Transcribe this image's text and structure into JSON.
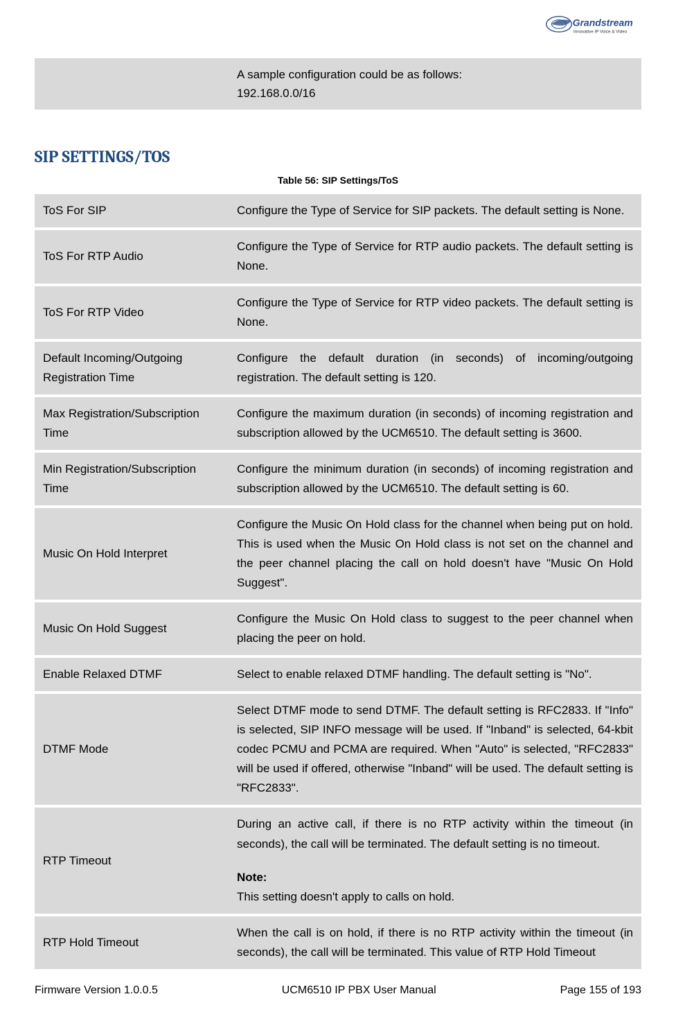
{
  "logo": {
    "brand": "Grandstream",
    "tagline": "Innovative IP Voice & Video"
  },
  "intro_row": {
    "label": "",
    "line1": "A sample configuration could be as follows:",
    "line2": "192.168.0.0/16"
  },
  "section_title": "SIP SETTINGS/TOS",
  "table_caption": "Table 56: SIP Settings/ToS",
  "rows": [
    {
      "label": "ToS For SIP",
      "desc": "Configure the Type of Service for SIP packets. The default setting is None."
    },
    {
      "label": "ToS For RTP Audio",
      "desc": "Configure the Type of Service for RTP audio packets. The default setting is None."
    },
    {
      "label": "ToS For RTP Video",
      "desc": "Configure the Type of Service for RTP video packets. The default setting is None."
    },
    {
      "label": "Default Incoming/Outgoing Registration Time",
      "desc": "Configure the default duration (in seconds) of incoming/outgoing registration. The default setting is 120."
    },
    {
      "label": "Max Registration/Subscription Time",
      "desc": "Configure the maximum duration (in seconds) of incoming registration and subscription allowed by the UCM6510. The default setting is 3600."
    },
    {
      "label": "Min Registration/Subscription Time",
      "desc": "Configure the minimum duration (in seconds) of incoming registration and subscription allowed by the UCM6510. The default setting is 60."
    },
    {
      "label": "Music On Hold Interpret",
      "desc": "Configure the Music On Hold class for the channel when being put on hold. This is used when the Music On Hold class is not set on the channel and the peer channel placing the call on hold doesn't have \"Music On Hold Suggest\"."
    },
    {
      "label": "Music On Hold Suggest",
      "desc": "Configure the Music On Hold class to suggest to the peer channel when placing the peer on hold."
    },
    {
      "label": "Enable Relaxed DTMF",
      "desc": "Select to enable relaxed DTMF handling. The default setting is \"No\"."
    },
    {
      "label": "DTMF Mode",
      "desc": "Select DTMF mode to send DTMF. The default setting is RFC2833. If \"Info\" is selected, SIP INFO message will be used. If \"Inband\" is selected, 64-kbit codec PCMU and PCMA are required. When \"Auto\" is selected, \"RFC2833\" will be used if offered, otherwise \"Inband\" will be used. The default setting is \"RFC2833\"."
    },
    {
      "label": "RTP Timeout",
      "desc_before": "During an active call, if there is no RTP activity within the timeout (in seconds), the call will be terminated. The default setting is no timeout.",
      "note_label": "Note:",
      "note_text": "This setting doesn't apply to calls on hold."
    },
    {
      "label": "RTP Hold Timeout",
      "desc": "When the call is on hold, if there is no RTP activity within the timeout (in seconds), the call will be terminated. This value of RTP Hold Timeout"
    }
  ],
  "footer": {
    "left": "Firmware Version 1.0.0.5",
    "center": "UCM6510 IP PBX User Manual",
    "right": "Page 155 of 193"
  }
}
